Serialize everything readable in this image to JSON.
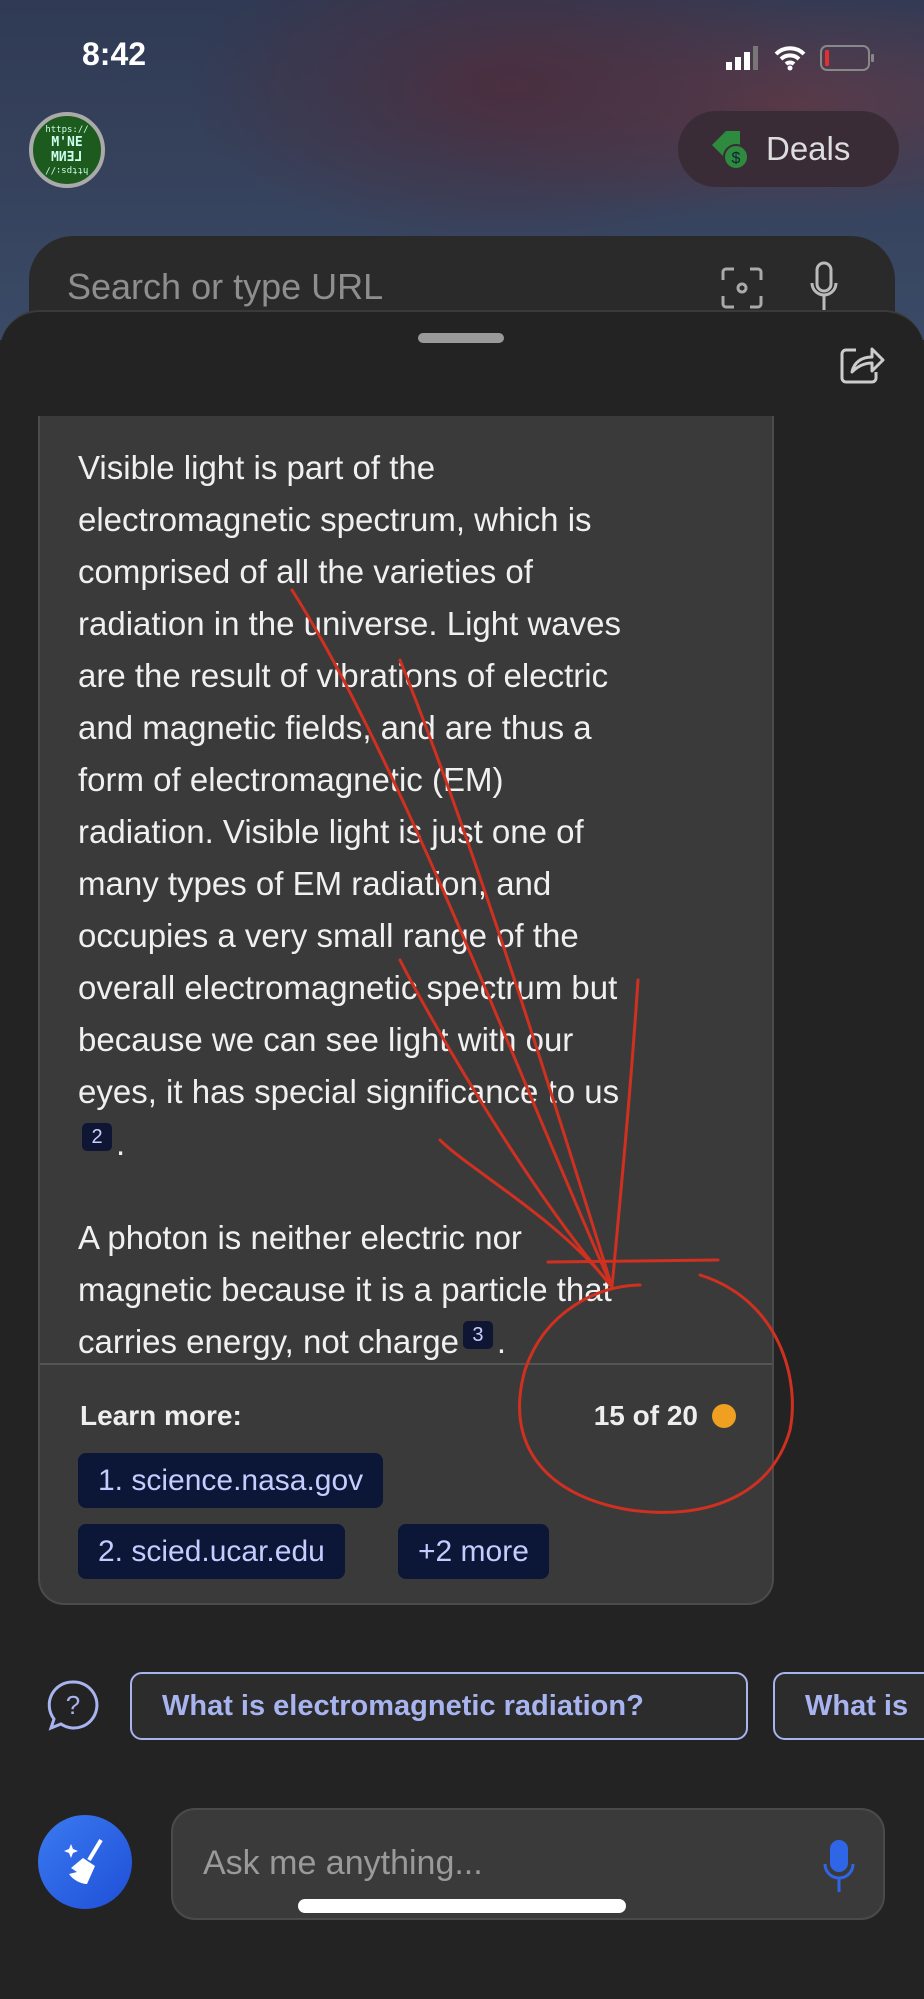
{
  "status_bar": {
    "time": "8:42",
    "battery_color": "#e03030"
  },
  "header": {
    "avatar_text": [
      "https://",
      "M'NE",
      "LENM",
      "https://"
    ],
    "deals_label": "Deals",
    "deals_icon": "price-tag-dollar-icon"
  },
  "search": {
    "placeholder": "Search or type URL"
  },
  "answer": {
    "paragraph1": [
      "Visible light is part of the",
      "electromagnetic spectrum, which is",
      "comprised of all the varieties of",
      "radiation in the universe. Light waves",
      "are the result of vibrations of electric",
      "and magnetic fields, and are thus a",
      "form of electromagnetic (EM)",
      "radiation. Visible light is just one of",
      "many types of EM radiation, and",
      "occupies a very small range of the",
      "overall electromagnetic spectrum but",
      "because we can see light with our",
      "eyes, it has special significance to us"
    ],
    "citation1": "2",
    "paragraph2": [
      "A photon is neither electric nor",
      "magnetic because it is a particle that",
      "carries energy, not charge"
    ],
    "citation2": "3",
    "learn_more_label": "Learn more:",
    "response_count": "15 of 20",
    "count_dot_color": "#f0a020",
    "sources": [
      "1. science.nasa.gov",
      "2. scied.ucar.edu",
      "+2 more"
    ]
  },
  "suggestions": [
    "What is electromagnetic radiation?",
    "What is"
  ],
  "input": {
    "placeholder": "Ask me anything..."
  },
  "accent_color": "#2f66e8",
  "annotation_color": "#d03020"
}
